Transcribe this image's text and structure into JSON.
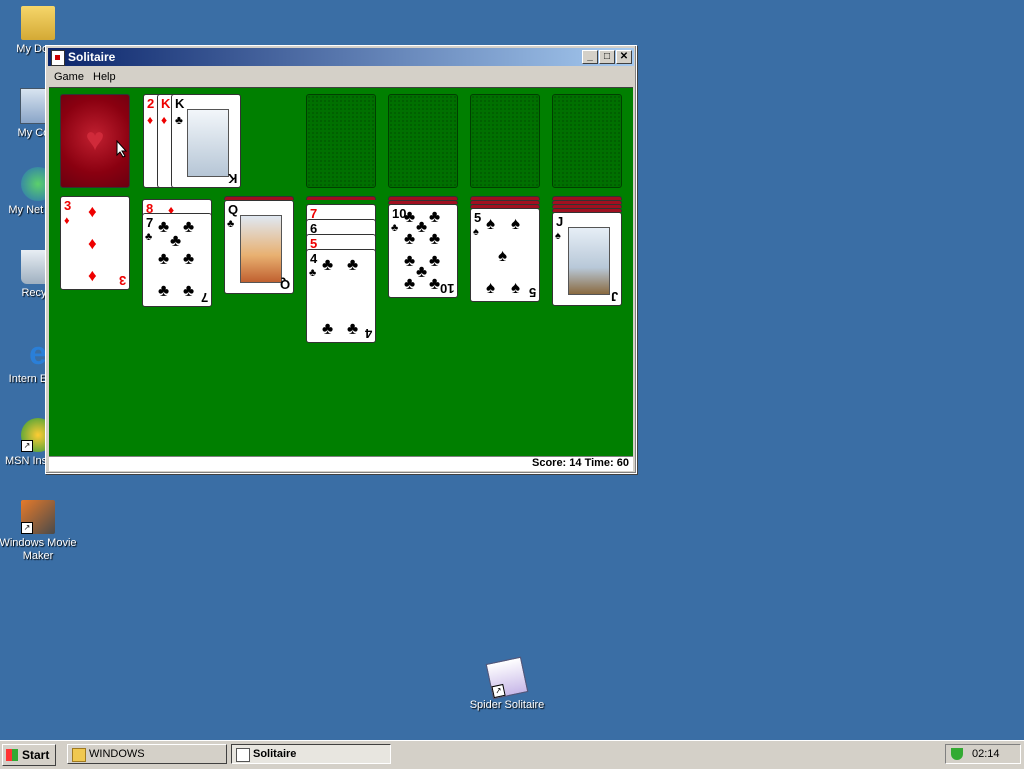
{
  "desktop": {
    "icons": [
      {
        "label": "My Docu"
      },
      {
        "label": "My Com"
      },
      {
        "label": "My Net Plac"
      },
      {
        "label": "Recycl"
      },
      {
        "label": "Intern Explo"
      },
      {
        "label": "MSN Installer"
      },
      {
        "label": "Windows Movie Maker"
      },
      {
        "label": "Spider Solitaire"
      }
    ]
  },
  "window": {
    "title": "Solitaire",
    "controls": {
      "minimize": "_",
      "maximize": "□",
      "close": "✕"
    },
    "menu": [
      "Game",
      "Help"
    ],
    "status": "Score: 14 Time: 60"
  },
  "cards": {
    "waste": [
      {
        "rank": "2",
        "suit": "♦"
      },
      {
        "rank": "K",
        "suit": "♦"
      },
      {
        "rank": "K",
        "suit": "♣",
        "rank_br": "K"
      }
    ],
    "piles": [
      {
        "top": {
          "rank": "3",
          "suit": "♦"
        }
      },
      {
        "covered": [
          {
            "rank": "8",
            "suit": "♦"
          }
        ],
        "top": {
          "rank": "7",
          "suit": "♣"
        }
      },
      {
        "top": {
          "rank": "Q",
          "suit": "♣"
        }
      },
      {
        "covered": [
          {
            "rank": "7",
            "suit": "♥"
          },
          {
            "rank": "6",
            "suit": "♠"
          },
          {
            "rank": "5",
            "suit": "♥"
          }
        ],
        "top": {
          "rank": "4",
          "suit": "♣"
        }
      },
      {
        "top": {
          "rank": "10",
          "suit": "♣"
        }
      },
      {
        "top": {
          "rank": "5",
          "suit": "♠"
        }
      },
      {
        "top": {
          "rank": "J",
          "suit": "♠"
        }
      }
    ]
  },
  "taskbar": {
    "start": "Start",
    "tasks": [
      {
        "label": "WINDOWS"
      },
      {
        "label": "Solitaire"
      }
    ],
    "clock": "02:14"
  },
  "colors": {
    "desktop": "#3a6ea5",
    "felt": "#007f00",
    "red_suit": "#e00000",
    "title_active": "#0a246a"
  }
}
